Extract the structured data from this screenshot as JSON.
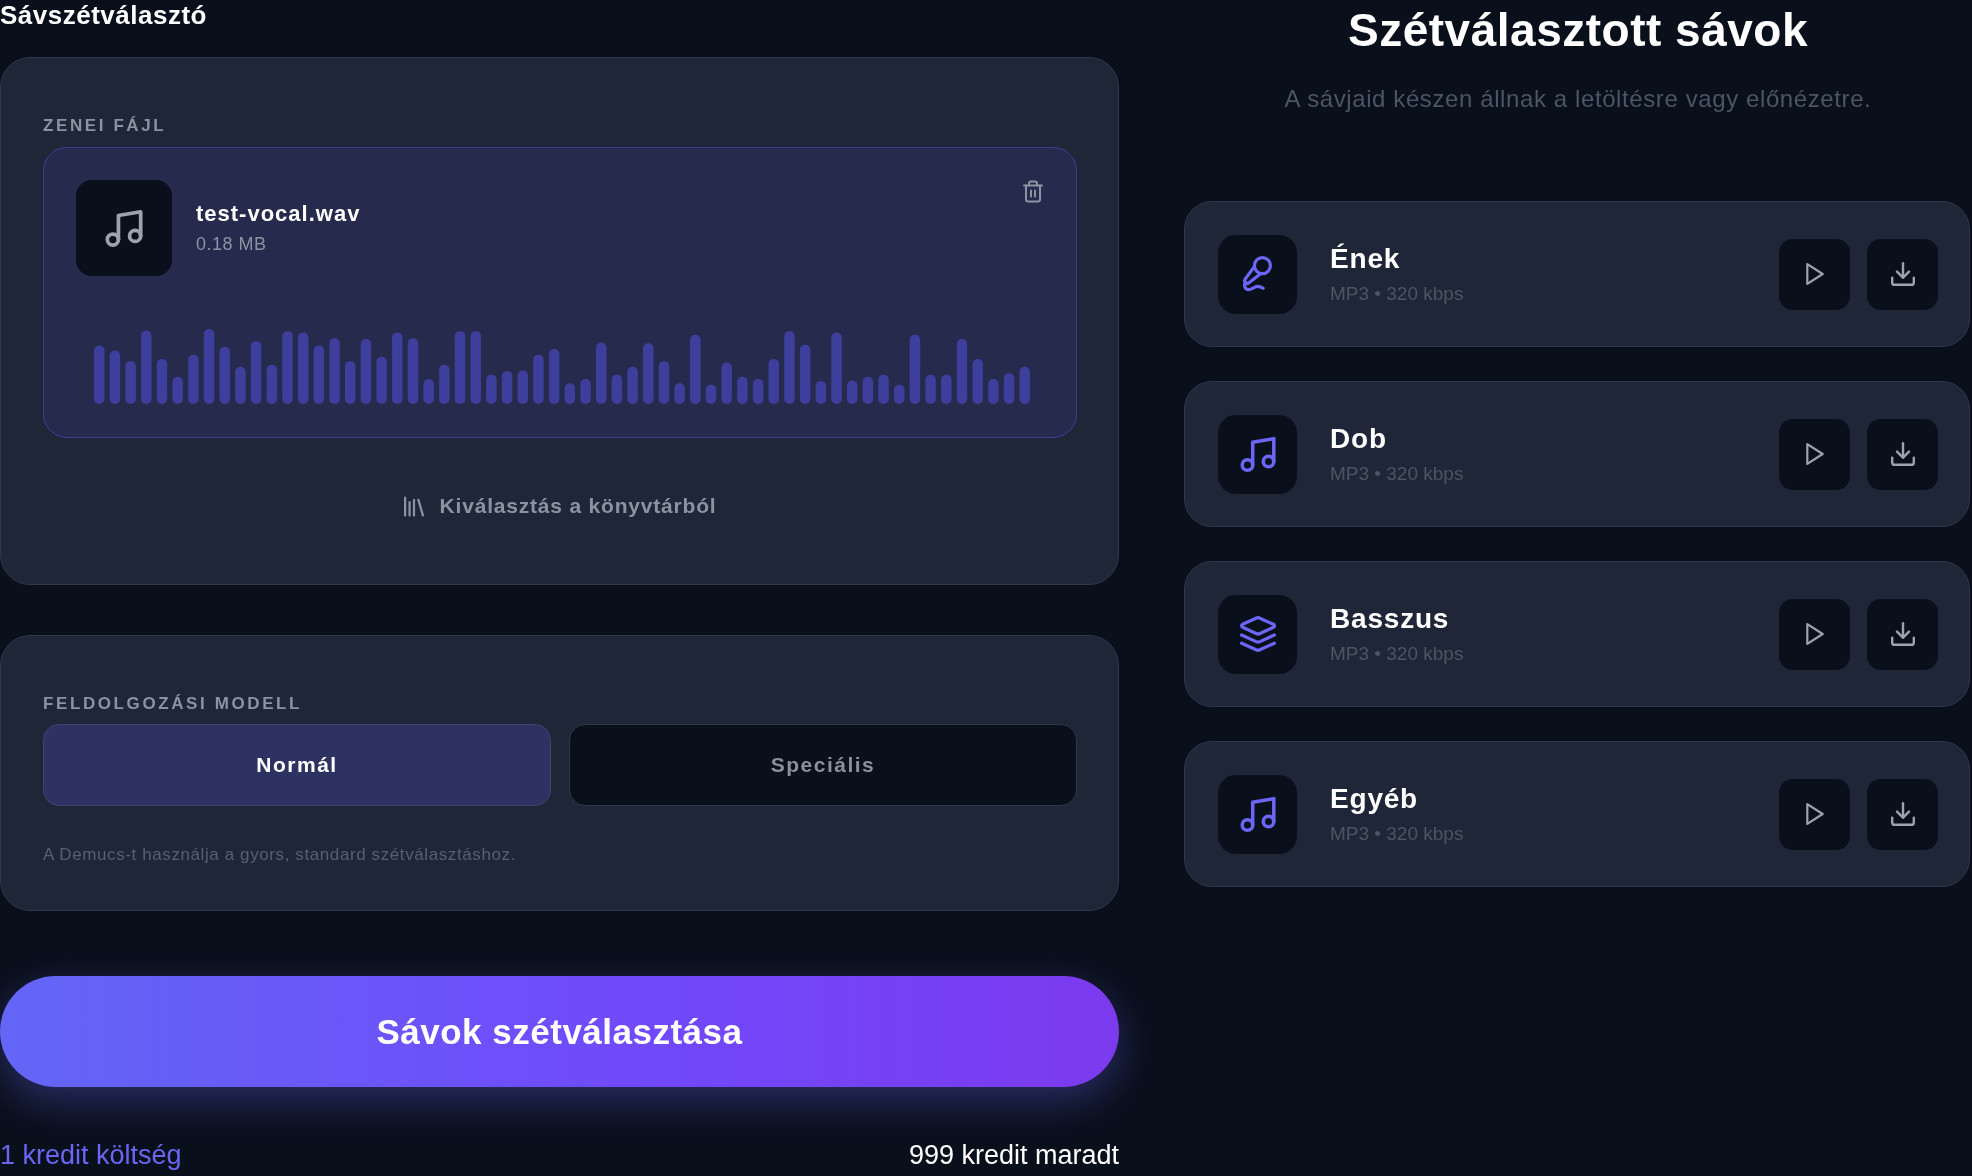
{
  "app": {
    "title": "Sávszétválasztó"
  },
  "file_card": {
    "label": "ZENEI FÁJL",
    "file": {
      "name": "test-vocal.wav",
      "size": "0.18 MB"
    },
    "library_link": "Kiválasztás a könyvtárból"
  },
  "model_card": {
    "label": "FELDOLGOZÁSI MODELL",
    "options": [
      {
        "label": "Normál",
        "selected": true
      },
      {
        "label": "Speciális",
        "selected": false
      }
    ],
    "hint": "A Demucs-t használja a gyors, standard szétválasztáshoz."
  },
  "separate_button": {
    "label": "Sávok szétválasztása"
  },
  "credits": {
    "cost": "1 kredit költség",
    "remaining": "999 kredit maradt"
  },
  "results": {
    "title": "Szétválasztott sávok",
    "subtitle": "A sávjaid készen állnak a letöltésre vagy előnézetre.",
    "tracks": [
      {
        "kind": "microphone",
        "name": "Ének",
        "format": "MP3 • 320 kbps"
      },
      {
        "kind": "music",
        "name": "Dob",
        "format": "MP3 • 320 kbps"
      },
      {
        "kind": "layers",
        "name": "Basszus",
        "format": "MP3 • 320 kbps"
      },
      {
        "kind": "music",
        "name": "Egyéb",
        "format": "MP3 • 320 kbps"
      }
    ]
  }
}
